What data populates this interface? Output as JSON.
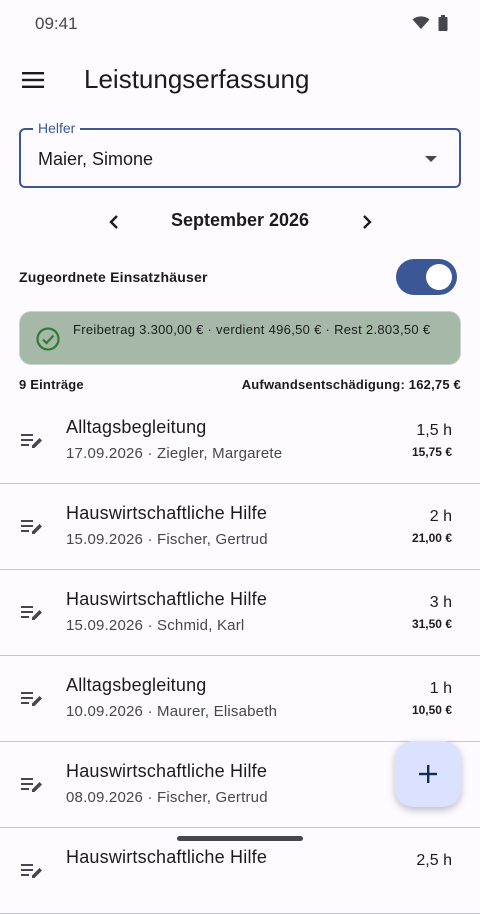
{
  "status_bar": {
    "time": "09:41",
    "icons": [
      "wifi-icon",
      "battery-icon"
    ]
  },
  "app_bar": {
    "title": "Leistungserfassung",
    "menu_icon": "menu-icon"
  },
  "helper_select": {
    "label": "Helfer",
    "value": "Maier, Simone"
  },
  "month_nav": {
    "label": "September 2026"
  },
  "assigned_toggle": {
    "label": "Zugeordnete Einsatzhäuser",
    "on": true
  },
  "allowance_info": {
    "text": "Freibetrag 3.300,00 € · verdient 496,50 € · Rest 2.803,50 €",
    "icon": "check-circle-icon"
  },
  "summary": {
    "count": "9 Einträge",
    "total": "Aufwandsentschädigung: 162,75 €"
  },
  "entries": [
    {
      "title": "Alltagsbegleitung",
      "subtitle": "17.09.2026 · Ziegler, Margarete",
      "hours": "1,5 h",
      "amount": "15,75 €"
    },
    {
      "title": "Hauswirtschaftliche Hilfe",
      "subtitle": "15.09.2026 · Fischer, Gertrud",
      "hours": "2 h",
      "amount": "21,00 €"
    },
    {
      "title": "Hauswirtschaftliche Hilfe",
      "subtitle": "15.09.2026 · Schmid, Karl",
      "hours": "3 h",
      "amount": "31,50 €"
    },
    {
      "title": "Alltagsbegleitung",
      "subtitle": "10.09.2026 · Maurer, Elisabeth",
      "hours": "1 h",
      "amount": "10,50 €"
    },
    {
      "title": "Hauswirtschaftliche Hilfe",
      "subtitle": "08.09.2026 · Fischer, Gertrud",
      "hours": "",
      "amount": ""
    },
    {
      "title": "Hauswirtschaftliche Hilfe",
      "subtitle": "",
      "hours": "2,5 h",
      "amount": ""
    }
  ],
  "colors": {
    "primary": "#3b5795",
    "info_bg": "#a6b9a9",
    "fab_bg": "#dae2ff",
    "success": "#2e7d32"
  }
}
